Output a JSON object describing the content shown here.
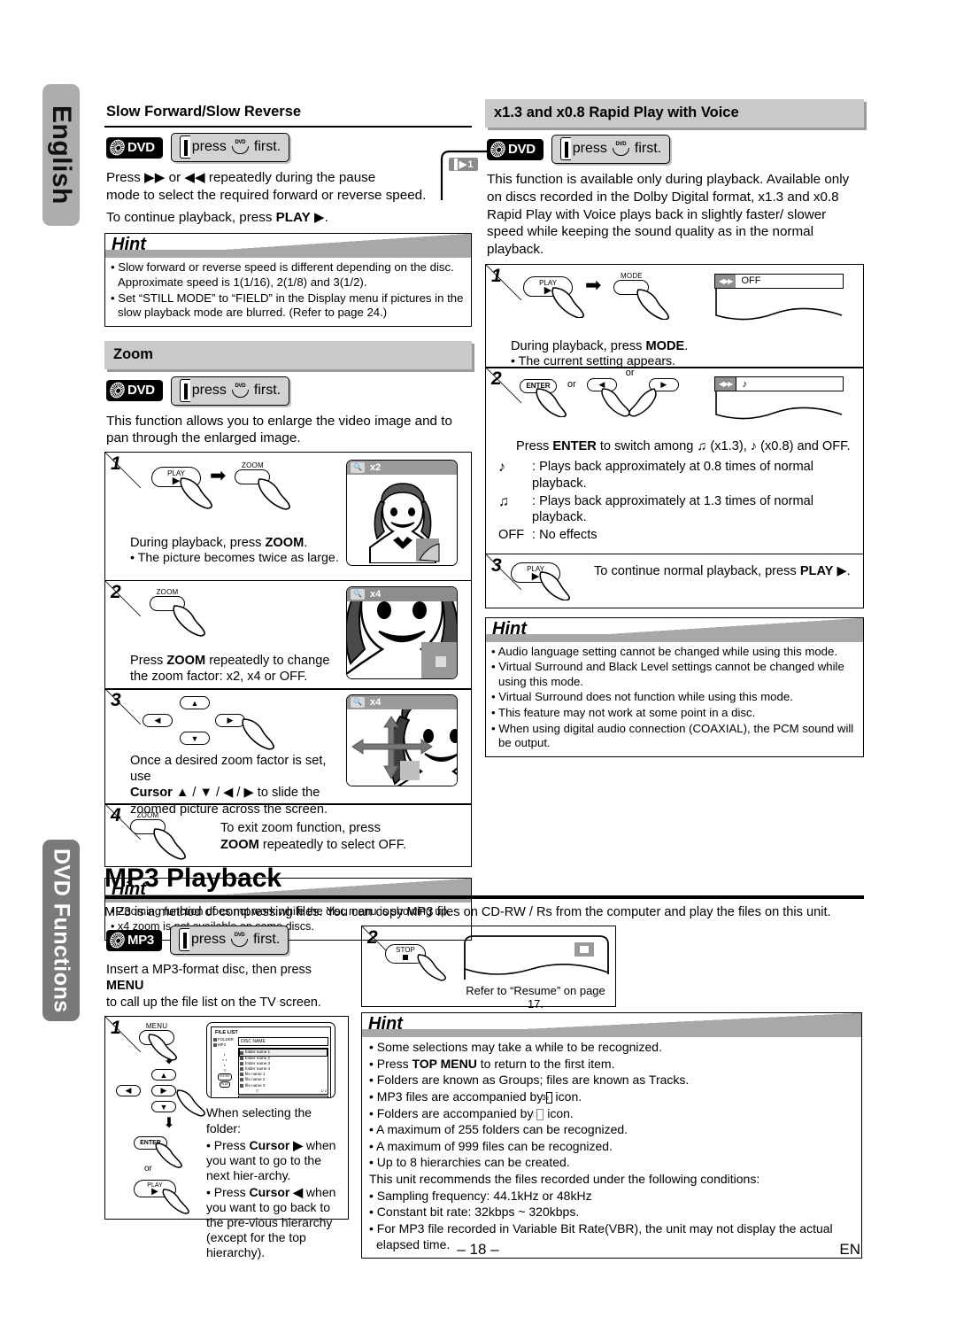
{
  "side_tabs": [
    {
      "label": "English"
    },
    {
      "label": "DVD Functions"
    }
  ],
  "left_column": {
    "slow_section": {
      "title": "Slow Forward/Slow Reverse",
      "badge": {
        "disc": "DVD",
        "press_text_a": "press",
        "press_text_b": "first.",
        "key_label": "DVD"
      },
      "display_indicator": "1",
      "paragraphs": [
        "Press ▶▶ or ◀◀ repeatedly during the pause",
        "mode to select the required forward or reverse speed."
      ],
      "continue_text_a": "To continue playback, press ",
      "continue_bold": "PLAY",
      "continue_text_b": " ▶."
    },
    "slow_hint": {
      "title": "Hint",
      "items": [
        "Slow forward or reverse speed is different depending on the disc. Approximate speed is 1(1/16), 2(1/8) and 3(1/2).",
        "Set “STILL MODE”  to “FIELD” in the Display menu if pictures in the slow playback mode are blurred. (Refer to page 24.)"
      ]
    },
    "zoom_section": {
      "title": "Zoom",
      "badge": {
        "disc": "DVD",
        "press_text_a": "press",
        "press_text_b": "first.",
        "key_label": "DVD"
      },
      "intro": "This function allows you to enlarge the video image and to pan through the enlarged image.",
      "steps": [
        {
          "num": "1",
          "buttons": [
            "PLAY",
            "ZOOM"
          ],
          "line_a_pre": "During playback, press ",
          "line_a_bold": "ZOOM",
          "line_a_post": ".",
          "bullet": "• The picture becomes twice as large.",
          "osd": "x2"
        },
        {
          "num": "2",
          "buttons": [
            "ZOOM"
          ],
          "line_a_pre": "Press ",
          "line_a_bold": "ZOOM",
          "line_a_post": " repeatedly to change",
          "line_b": "the zoom factor: x2, x4 or OFF.",
          "osd": "x4"
        },
        {
          "num": "3",
          "line_a": "Once a desired zoom factor is set, use",
          "line_b_bold": "Cursor",
          "line_b": " ▲ / ▼ / ◀ / ▶ to slide the",
          "line_c": "zoomed picture across the screen.",
          "osd": "x4"
        },
        {
          "num": "4",
          "buttons": [
            "ZOOM"
          ],
          "line_a": "To exit zoom function, press",
          "line_b_bold": "ZOOM",
          "line_b": " repeatedly to select OFF."
        }
      ]
    },
    "zoom_hint": {
      "title": "Hint",
      "items": [
        "Zooming function does not work while the disc menu is showing up.",
        "x4 zoom is not available on some discs."
      ]
    }
  },
  "right_column": {
    "rapid_section": {
      "title": "x1.3 and x0.8 Rapid Play with Voice",
      "badge": {
        "disc": "DVD",
        "press_text_a": "press",
        "press_text_b": "first.",
        "key_label": "DVD"
      },
      "intro": "This function is available only during playback. Available only on discs recorded in the Dolby Digital format, x1.3 and x0.8 Rapid Play with Voice plays back in slightly faster/ slower speed while keeping the sound quality as in the normal playback.",
      "steps": [
        {
          "num": "1",
          "buttons": [
            "PLAY",
            "MODE"
          ],
          "display_value": "OFF",
          "line_a_pre": "During playback, press ",
          "line_a_bold": "MODE",
          "line_a_post": ".",
          "bullet": "• The current setting appears."
        },
        {
          "num": "2",
          "buttons": [
            "ENTER",
            "or",
            "◀",
            "or",
            "▶"
          ],
          "display_value": "♪",
          "line_main_pre": "Press ",
          "line_main_bold": "ENTER",
          "line_main_post": " to switch among  ♫ (x1.3),  ♪ (x0.8) and OFF.",
          "defs": [
            {
              "sym": "♪",
              "text": ": Plays back approximately at 0.8 times of normal playback."
            },
            {
              "sym": "♫",
              "text": ": Plays back approximately at 1.3 times of normal playback."
            },
            {
              "sym": "OFF",
              "text": ": No effects"
            }
          ]
        },
        {
          "num": "3",
          "buttons": [
            "PLAY"
          ],
          "line_a_pre": "To continue normal playback, press ",
          "line_a_bold": "PLAY",
          "line_a_post": " ▶."
        }
      ]
    },
    "rapid_hint": {
      "title": "Hint",
      "items": [
        "Audio language setting cannot be changed while using this mode.",
        "Virtual Surround and Black Level settings cannot be changed while using this mode.",
        "Virtual Surround does not function while using this mode.",
        "This feature may not work at some point in a disc.",
        "When using digital audio connection (COAXIAL), the PCM sound will be output."
      ]
    }
  },
  "mp3_section": {
    "title": "MP3 Playback",
    "intro": "MP3 is a method of compressing files. You can copy MP3 files on CD-RW / Rs from the computer and play the files on this unit.",
    "badge": {
      "disc": "MP3",
      "press_text_a": "press",
      "press_text_b": "first.",
      "key_label": "DVD"
    },
    "lead_a": "Insert a MP3-format disc, then press ",
    "lead_bold": "MENU",
    "lead_b": "",
    "lead_c": "to call up the file list on the TV screen.",
    "step1": {
      "num": "1",
      "buttons": [
        "MENU",
        "▲",
        "◀",
        "▶",
        "▼",
        "ENTER",
        "or",
        "PLAY"
      ],
      "file_list": {
        "title": "FILE LIST",
        "legend": [
          "FOLDER",
          "MP3"
        ],
        "disc_name": "DISC NAME",
        "items": [
          "folder name 1",
          "folder name 2",
          "folder name 3",
          "folder name 4",
          "file name 1",
          "file name 2",
          "file name 3"
        ],
        "page": "1/  2",
        "footer": "folder name 1"
      },
      "heading": "When selecting the folder:",
      "bullets": [
        {
          "pre": "• Press ",
          "bold": "Cursor ▶",
          "post": " when you want to go to the next hier-archy."
        },
        {
          "pre": "• Press ",
          "bold": "Cursor ◀",
          "post": " when you want to go back to the pre-vious hierarchy (except for the top hierarchy)."
        }
      ]
    },
    "step2": {
      "num": "2",
      "buttons": [
        "STOP"
      ],
      "caption": "Refer to “Resume” on page 17."
    },
    "hint": {
      "title": "Hint",
      "items": [
        {
          "text": "Some selections may take a while to be recognized.",
          "bullet": true
        },
        {
          "pre": "Press ",
          "bold": "TOP MENU",
          "post": " to return to the first item.",
          "bullet": true
        },
        {
          "text": "Folders are known as Groups; files are known as Tracks.",
          "bullet": true
        },
        {
          "text": "MP3 files are accompanied by        icon.",
          "bullet": true,
          "icon": "mp3-file-icon"
        },
        {
          "text": "Folders are accompanied by        icon.",
          "bullet": true,
          "icon": "folder-icon"
        },
        {
          "text": "A maximum of 255 folders can be recognized.",
          "bullet": true
        },
        {
          "text": "A maximum of 999 files can be recognized.",
          "bullet": true
        },
        {
          "text": "Up to 8 hierarchies can be created.",
          "bullet": true
        },
        {
          "text": "This unit recommends the files recorded under the following conditions:",
          "bullet": false
        },
        {
          "text": "Sampling frequency: 44.1kHz or 48kHz",
          "bullet": true
        },
        {
          "text": "Constant bit rate: 32kbps ~ 320kbps.",
          "bullet": true
        },
        {
          "text": "For MP3 file recorded in Variable Bit Rate(VBR), the unit may not display the actual elapsed time.",
          "bullet": true
        }
      ]
    }
  },
  "footer": {
    "page_number": "– 18 –",
    "language_mark": "EN"
  },
  "colors": {
    "tab_gray": "#adadad",
    "tab_dark": "#7a7a7a",
    "heading_gray": "#c9c9c9",
    "hint_gray": "#a8a8a8",
    "osd_gray": "#9a9a9a"
  }
}
